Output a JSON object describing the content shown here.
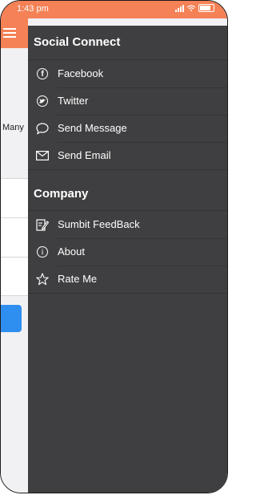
{
  "status_bar": {
    "time": "1:43 pm"
  },
  "background": {
    "partial_text": "Many"
  },
  "drawer": {
    "sections": [
      {
        "title": "Social Connect",
        "items": [
          {
            "label": "Facebook",
            "icon": "facebook-icon"
          },
          {
            "label": "Twitter",
            "icon": "twitter-icon"
          },
          {
            "label": "Send Message",
            "icon": "chat-bubble-icon"
          },
          {
            "label": "Send Email",
            "icon": "envelope-icon"
          }
        ]
      },
      {
        "title": "Company",
        "items": [
          {
            "label": "Sumbit FeedBack",
            "icon": "edit-note-icon"
          },
          {
            "label": "About",
            "icon": "info-icon"
          },
          {
            "label": "Rate Me",
            "icon": "star-icon"
          }
        ]
      }
    ]
  },
  "colors": {
    "accent": "#f58156",
    "drawer_bg": "#3f3f41",
    "primary_button": "#2f8ff0"
  }
}
